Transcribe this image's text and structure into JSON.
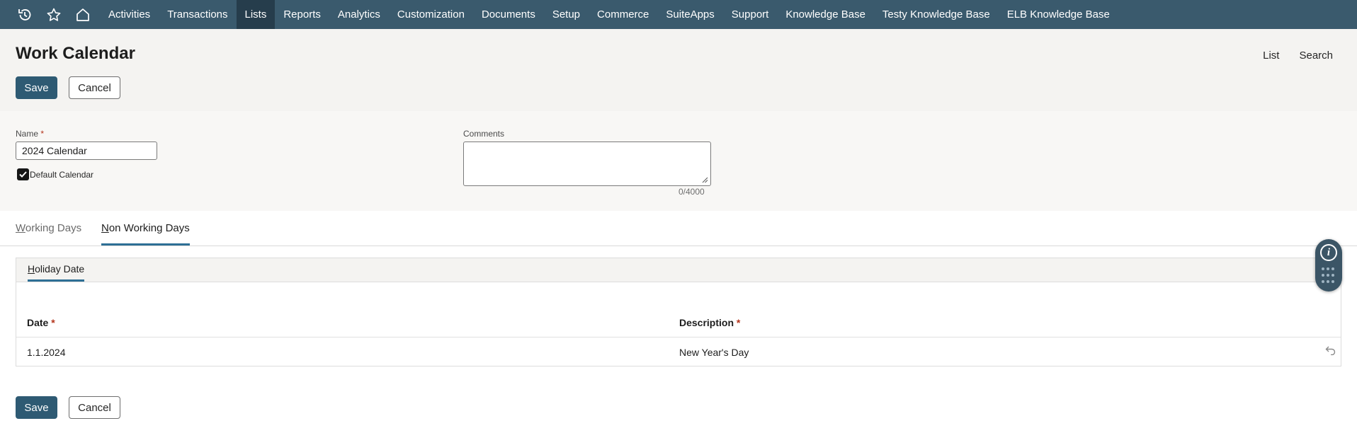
{
  "nav": {
    "icons": [
      "history-icon",
      "star-icon",
      "home-icon"
    ],
    "items": [
      {
        "label": "Activities"
      },
      {
        "label": "Transactions"
      },
      {
        "label": "Lists",
        "active": true
      },
      {
        "label": "Reports"
      },
      {
        "label": "Analytics"
      },
      {
        "label": "Customization"
      },
      {
        "label": "Documents"
      },
      {
        "label": "Setup"
      },
      {
        "label": "Commerce"
      },
      {
        "label": "SuiteApps"
      },
      {
        "label": "Support"
      },
      {
        "label": "Knowledge Base"
      },
      {
        "label": "Testy Knowledge Base"
      },
      {
        "label": "ELB Knowledge Base"
      }
    ]
  },
  "header": {
    "title": "Work Calendar",
    "links": {
      "list": "List",
      "search": "Search"
    },
    "save_label": "Save",
    "cancel_label": "Cancel"
  },
  "form": {
    "name_label": "Name",
    "required_mark": "*",
    "name_value": "2024 Calendar",
    "default_calendar_label": "Default Calendar",
    "default_calendar_checked": true,
    "comments_label": "Comments",
    "comments_value": "",
    "comments_counter": "0/4000"
  },
  "tabs": [
    {
      "label": "Working Days",
      "accesskey": "W",
      "rest": "orking Days",
      "active": false
    },
    {
      "label": "Non Working Days",
      "accesskey": "N",
      "rest": "on Working Days",
      "active": true
    }
  ],
  "sublist": {
    "tab_label": "Holiday Date",
    "tab_accesskey": "H",
    "tab_rest": "oliday Date",
    "columns": {
      "date": "Date",
      "description": "Description"
    },
    "rows": [
      {
        "date": "1.1.2024",
        "description": "New Year's Day"
      }
    ]
  },
  "footer": {
    "save_label": "Save",
    "cancel_label": "Cancel"
  },
  "colors": {
    "nav_bg": "#3a5a6d",
    "nav_active": "#263d4c",
    "primary_button": "#2e5a73",
    "tab_underline": "#2e6f95",
    "required": "#b4341c"
  }
}
